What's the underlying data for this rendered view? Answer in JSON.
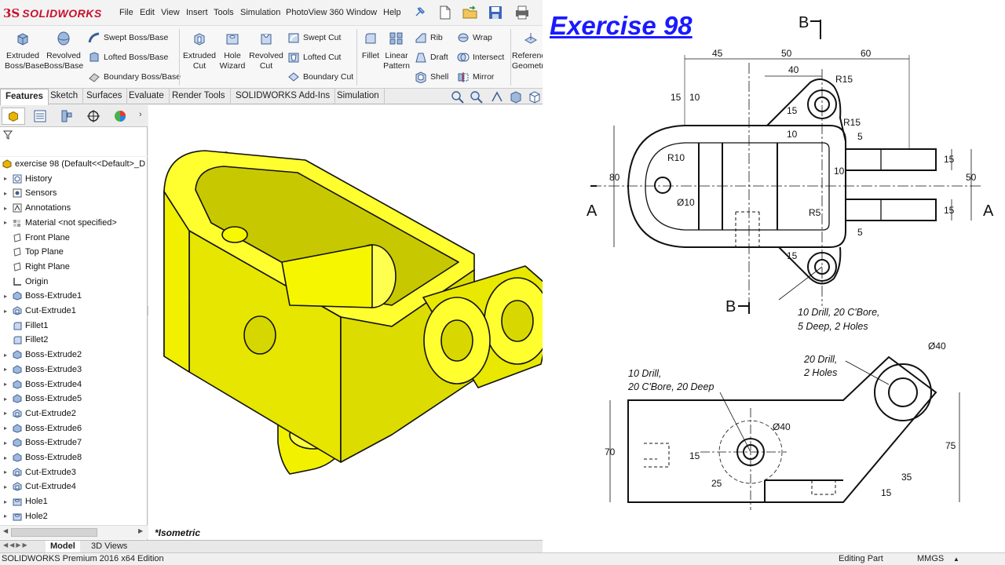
{
  "app": {
    "logo_ds": "3S",
    "logo_text": "SOLIDWORKS",
    "menu": [
      "File",
      "Edit",
      "View",
      "Insert",
      "Tools",
      "Simulation",
      "PhotoView 360",
      "Window",
      "Help"
    ]
  },
  "command_manager": {
    "extruded_boss": "Extruded Boss/Base",
    "revolved_boss": "Revolved Boss/Base",
    "swept_boss": "Swept Boss/Base",
    "lofted_boss": "Lofted Boss/Base",
    "boundary_boss": "Boundary Boss/Base",
    "extruded_cut": "Extruded Cut",
    "hole_wizard": "Hole Wizard",
    "revolved_cut": "Revolved Cut",
    "swept_cut": "Swept Cut",
    "lofted_cut": "Lofted Cut",
    "boundary_cut": "Boundary Cut",
    "fillet": "Fillet",
    "linear_pattern": "Linear Pattern",
    "rib": "Rib",
    "draft": "Draft",
    "shell": "Shell",
    "wrap": "Wrap",
    "intersect": "Intersect",
    "mirror": "Mirror",
    "reference_geometry": "Reference Geometry"
  },
  "tabs": [
    "Features",
    "Sketch",
    "Surfaces",
    "Evaluate",
    "Render Tools",
    "SOLIDWORKS Add-Ins",
    "Simulation"
  ],
  "tree": {
    "root": "exercise 98  (Default<<Default>_D",
    "items": [
      "History",
      "Sensors",
      "Annotations",
      "Material <not specified>",
      "Front Plane",
      "Top Plane",
      "Right Plane",
      "Origin",
      "Boss-Extrude1",
      "Cut-Extrude1",
      "Fillet1",
      "Fillet2",
      "Boss-Extrude2",
      "Boss-Extrude3",
      "Boss-Extrude4",
      "Boss-Extrude5",
      "Cut-Extrude2",
      "Boss-Extrude6",
      "Boss-Extrude7",
      "Boss-Extrude8",
      "Cut-Extrude3",
      "Cut-Extrude4",
      "Hole1",
      "Hole2"
    ]
  },
  "bottom_tabs": [
    "Model",
    "3D Views"
  ],
  "viewport": {
    "view_label": "*Isometric",
    "part_color": "#ffff00"
  },
  "status": {
    "edition": "SOLIDWORKS Premium 2016 x64 Edition",
    "mode": "Editing Part",
    "units": "MMGS"
  },
  "drawing": {
    "title": "Exercise 98",
    "section_labels": {
      "b": "B",
      "a": "A"
    },
    "dims_top": [
      "45",
      "50",
      "60",
      "40",
      "15",
      "10",
      "80",
      "50",
      "15",
      "15",
      "10",
      "5",
      "5",
      "10",
      "15",
      "15"
    ],
    "radii": [
      "R15",
      "R15",
      "R10",
      "R5",
      "Ø10"
    ],
    "note_top_1": "10 Drill, 20 C'Bore,",
    "note_top_2": "5 Deep, 2 Holes",
    "note_bottom_left_1": "10 Drill,",
    "note_bottom_left_2": "20 C'Bore, 20 Deep",
    "note_bottom_right_1": "20 Drill,",
    "note_bottom_right_2": "2 Holes",
    "dims_front": [
      "Ø40",
      "Ø40",
      "70",
      "75",
      "15",
      "25",
      "35",
      "15"
    ]
  },
  "colors": {
    "accent": "#1a1aff",
    "logo": "#c8102e",
    "part": "#ffff00"
  }
}
